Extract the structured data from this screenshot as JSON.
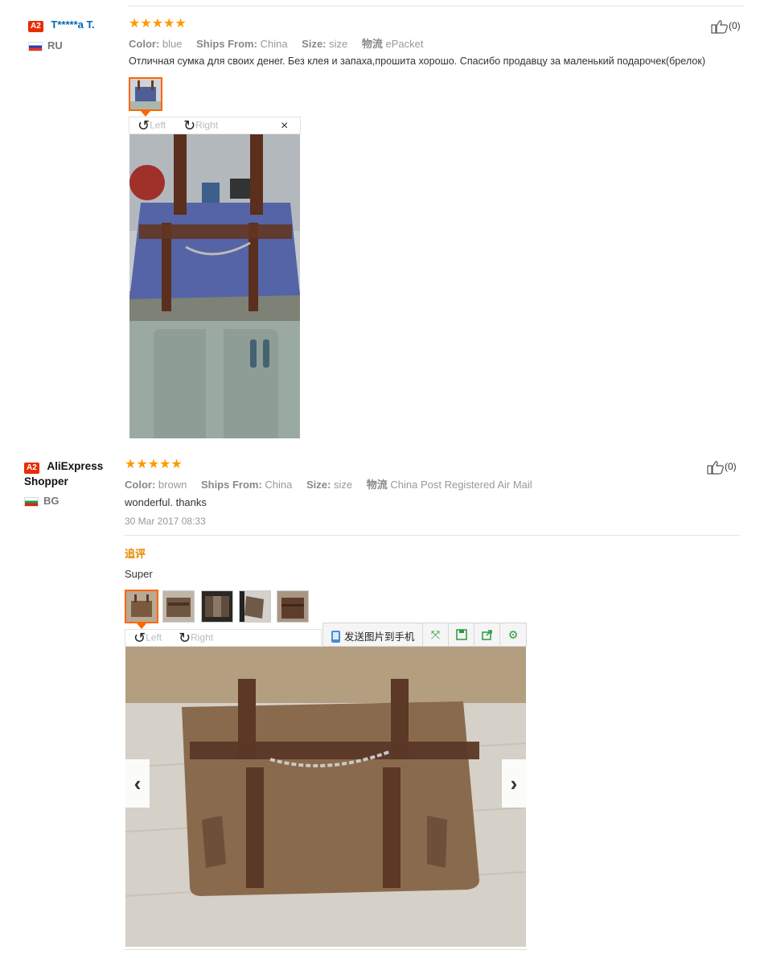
{
  "review1": {
    "badge": "A2",
    "user": "T*****a T.",
    "country": "RU",
    "stars": "★★★★★",
    "attrs": {
      "color_label": "Color:",
      "color_value": "blue",
      "ships_label": "Ships From:",
      "ships_value": "China",
      "size_label": "Size:",
      "size_value": "size",
      "logistics_label": "物流",
      "logistics_value": "ePacket"
    },
    "text": "Отличная сумка для своих денег. Без клея и запаха,прошита хорошо. Спасибо продавцу за маленький подарочек(брелок)",
    "helpful": "(0)",
    "viewer": {
      "left": "Left",
      "right": "Right",
      "close": "×"
    }
  },
  "review2": {
    "badge": "A2",
    "user_line1": "AliExpress",
    "user_line2": "Shopper",
    "country": "BG",
    "stars": "★★★★★",
    "attrs": {
      "color_label": "Color:",
      "color_value": "brown",
      "ships_label": "Ships From:",
      "ships_value": "China",
      "size_label": "Size:",
      "size_value": "size",
      "logistics_label": "物流",
      "logistics_value": "China Post Registered Air Mail"
    },
    "text": "wonderful. thanks",
    "date": "30 Mar 2017 08:33",
    "helpful": "(0)",
    "followup_label": "追评",
    "followup_text": "Super",
    "viewer": {
      "left": "Left",
      "right": "Right"
    },
    "toolbar": {
      "send_label": "发送图片到手机"
    },
    "nav": {
      "prev": "‹",
      "next": "›"
    }
  },
  "colors": {
    "accent": "#ff6600",
    "star": "#ff9a00",
    "link": "#0068b5",
    "badge": "#e62e04"
  },
  "icons": [
    "thumbs-up-icon",
    "rotate-left-icon",
    "rotate-right-icon",
    "close-icon",
    "expand-icon",
    "save-icon",
    "share-icon",
    "settings-icon",
    "chevron-left-icon",
    "chevron-right-icon"
  ]
}
